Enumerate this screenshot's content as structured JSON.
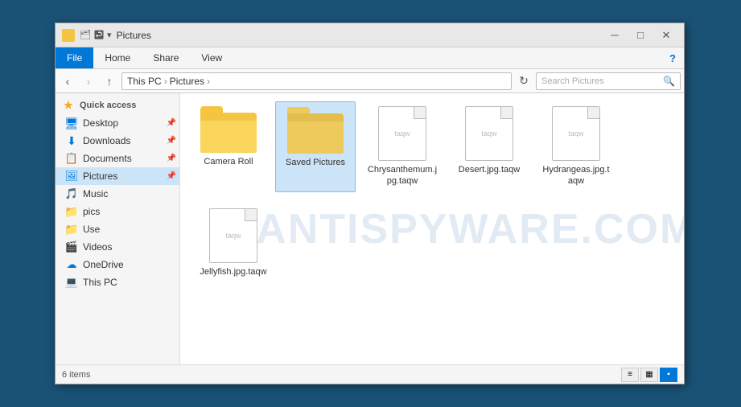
{
  "window": {
    "title": "Pictures",
    "icon_color": "#f5c542"
  },
  "title_bar": {
    "controls": {
      "minimize": "─",
      "maximize": "□",
      "close": "✕"
    }
  },
  "ribbon": {
    "tabs": [
      "File",
      "Home",
      "Share",
      "View"
    ],
    "active_tab": "File"
  },
  "address_bar": {
    "path_parts": [
      "This PC",
      "Pictures"
    ],
    "search_placeholder": "Search Pictures",
    "search_value": "Search Pictures"
  },
  "sidebar": {
    "items": [
      {
        "id": "quick-access",
        "label": "Quick access",
        "type": "header",
        "icon": "★"
      },
      {
        "id": "desktop",
        "label": "Desktop",
        "type": "item",
        "icon": "desktop",
        "pinned": true
      },
      {
        "id": "downloads",
        "label": "Downloads",
        "type": "item",
        "icon": "download",
        "pinned": true
      },
      {
        "id": "documents",
        "label": "Documents",
        "type": "item",
        "icon": "docs",
        "pinned": true
      },
      {
        "id": "pictures",
        "label": "Pictures",
        "type": "item",
        "icon": "pictures",
        "pinned": true,
        "active": true
      },
      {
        "id": "music",
        "label": "Music",
        "type": "item",
        "icon": "music"
      },
      {
        "id": "pics",
        "label": "pics",
        "type": "item",
        "icon": "folder-yellow"
      },
      {
        "id": "use",
        "label": "Use",
        "type": "item",
        "icon": "folder-yellow"
      },
      {
        "id": "videos",
        "label": "Videos",
        "type": "item",
        "icon": "videos"
      },
      {
        "id": "onedrive",
        "label": "OneDrive",
        "type": "item",
        "icon": "cloud"
      },
      {
        "id": "this-pc",
        "label": "This PC",
        "type": "item",
        "icon": "pc"
      }
    ]
  },
  "files": [
    {
      "id": "camera-roll",
      "name": "Camera Roll",
      "type": "folder"
    },
    {
      "id": "saved-pictures",
      "name": "Saved Pictures",
      "type": "folder",
      "selected": true
    },
    {
      "id": "chrysanthemum",
      "name": "Chrysanthemum.jpg.taqw",
      "type": "file"
    },
    {
      "id": "desert",
      "name": "Desert.jpg.taqw",
      "type": "file"
    },
    {
      "id": "hydrangeas",
      "name": "Hydrangeas.jpg.taqw",
      "type": "file"
    },
    {
      "id": "jellyfish",
      "name": "Jellyfish.jpg.taqw",
      "type": "file"
    }
  ],
  "watermark": "ANTISPYWARE.COM",
  "status": {
    "count": "6 items"
  },
  "view_buttons": [
    {
      "id": "details",
      "icon": "≡≡",
      "active": false
    },
    {
      "id": "list",
      "icon": "▦",
      "active": false
    },
    {
      "id": "tiles",
      "icon": "▪▪",
      "active": true
    }
  ]
}
